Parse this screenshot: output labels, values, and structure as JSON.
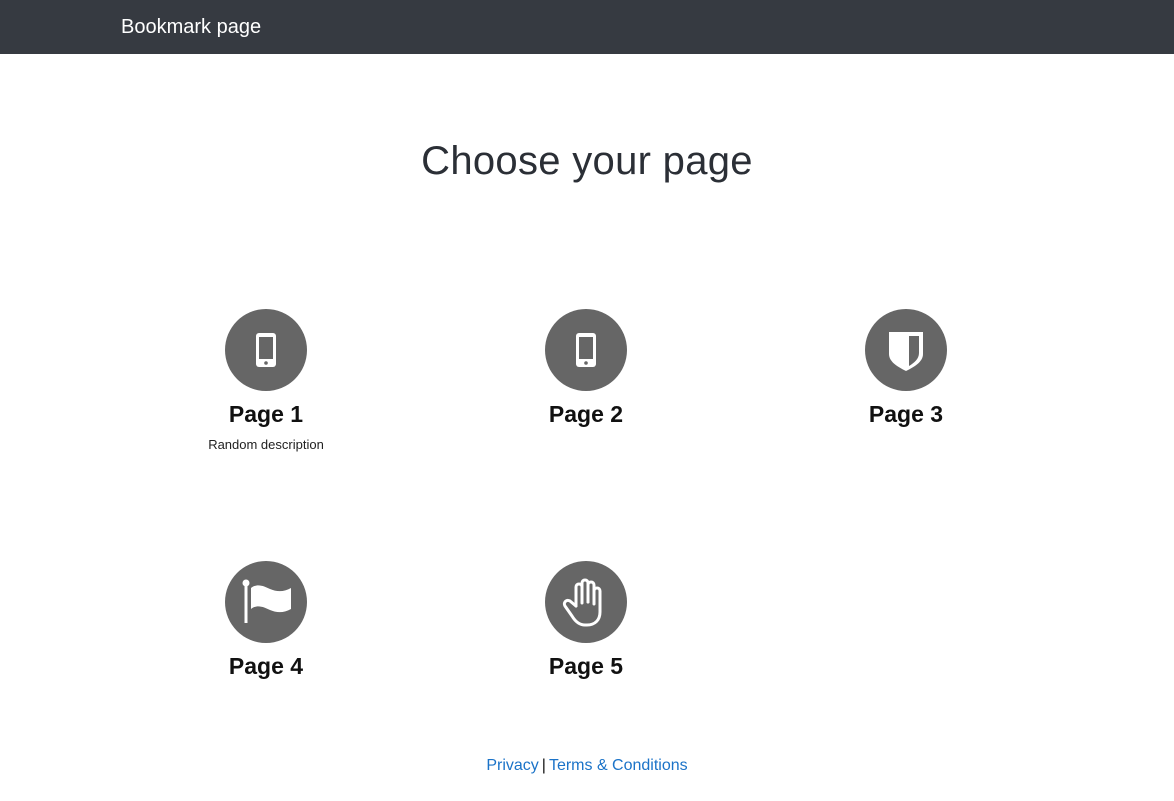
{
  "header": {
    "brand": "Bookmark page"
  },
  "main": {
    "title": "Choose your page",
    "tiles": [
      {
        "label": "Page 1",
        "description": "Random description",
        "icon": "mobile-phone-icon"
      },
      {
        "label": "Page 2",
        "icon": "mobile-phone-icon"
      },
      {
        "label": "Page 3",
        "icon": "shield-icon"
      },
      {
        "label": "Page 4",
        "icon": "flag-icon"
      },
      {
        "label": "Page 5",
        "icon": "hand-icon"
      }
    ]
  },
  "footer": {
    "privacy": "Privacy",
    "separator": "|",
    "terms": "Terms & Conditions"
  },
  "colors": {
    "navbar": "#363a41",
    "icon_circle": "#666666",
    "link": "#1b73c8"
  }
}
